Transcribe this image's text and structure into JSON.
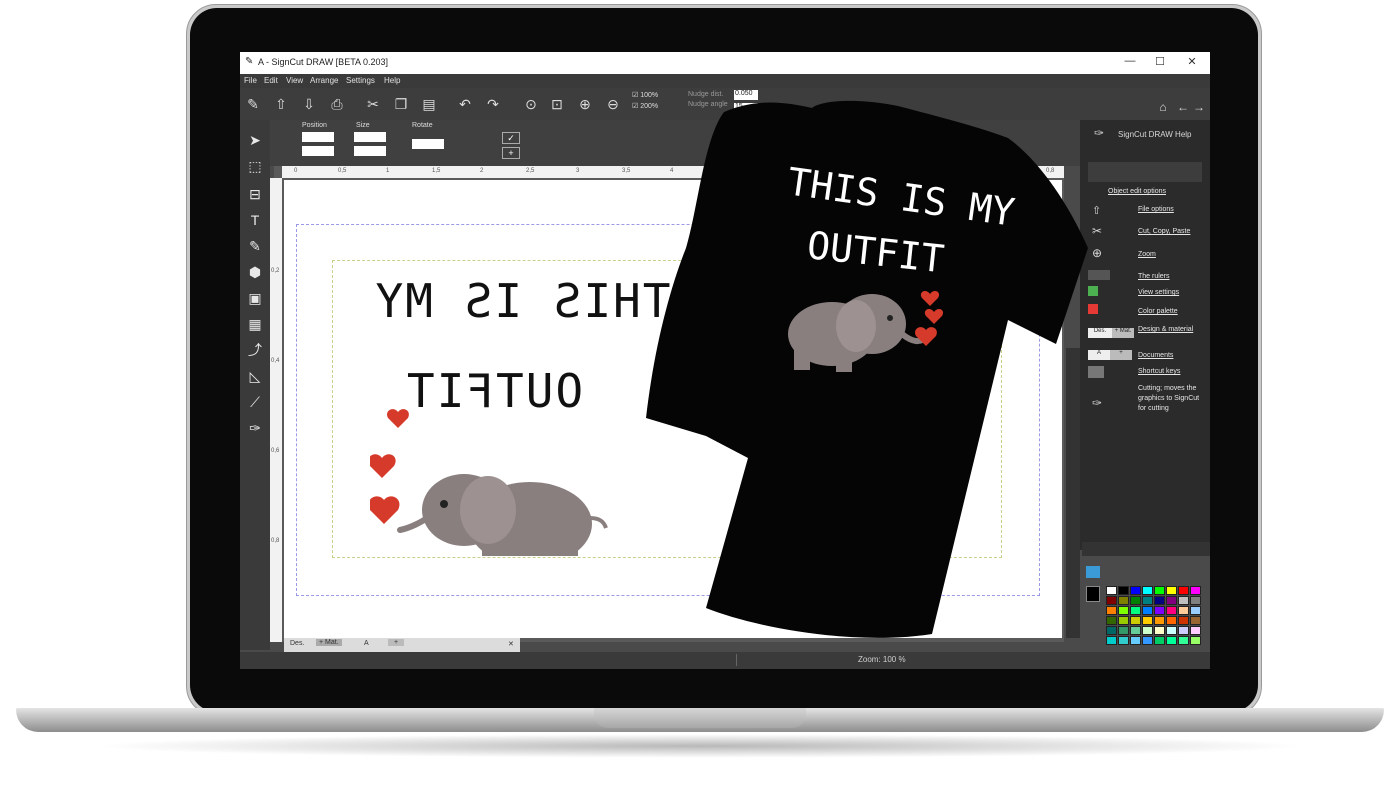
{
  "window": {
    "title": "A - SignCut DRAW  [BETA 0.203]",
    "controls": {
      "minimize": "—",
      "maximize": "☐",
      "close": "✕"
    }
  },
  "menu": [
    "File",
    "Edit",
    "View",
    "Arrange",
    "Settings",
    "Help"
  ],
  "toolbar": {
    "zoom_100": "100%",
    "zoom_200": "200%",
    "nudge_dist_label": "Nudge dist.",
    "nudge_dist_value": "0.050",
    "nudge_angle_label": "Nudge angle",
    "nudge_angle_value": "15"
  },
  "properties": {
    "position_label": "Position",
    "size_label": "Size",
    "rotate_label": "Rotate"
  },
  "ruler_h": [
    "0",
    "0,5",
    "1",
    "1,5",
    "2",
    "2,5",
    "3",
    "3,5",
    "4",
    "0,8"
  ],
  "ruler_v": [
    "0,2",
    "0,4",
    "0,6",
    "0,8"
  ],
  "canvas": {
    "mirrored_line1": "THIS IS MY",
    "mirrored_line2": "OUTFIT"
  },
  "tshirt": {
    "line1": "THIS IS MY",
    "line2": "OUTFIT"
  },
  "help_panel": {
    "title": "SignCut DRAW Help",
    "object_edit_options": "Object edit options",
    "items": [
      "File options",
      "Cut, Copy, Paste",
      "Zoom",
      "The rulers",
      "View settings",
      "Color palette",
      "Design & material",
      "Documents",
      "Shortcut keys"
    ],
    "cutting_note": "Cutting; moves the graphics to SignCut for cutting",
    "design_tab": "Des.",
    "material_tab": "+ Mat.",
    "doc_tab": "A",
    "add_doc": "+"
  },
  "bottom_tabs": {
    "des": "Des.",
    "mat": "+ Mat.",
    "doc": "A",
    "add": "+",
    "close": "✕"
  },
  "status": {
    "zoom": "Zoom: 100 %"
  },
  "palette_colors": [
    "#ffffff",
    "#000000",
    "#0000ff",
    "#00ffff",
    "#00ff00",
    "#ffff00",
    "#ff0000",
    "#ff00ff",
    "#800000",
    "#808000",
    "#008000",
    "#008080",
    "#000080",
    "#800080",
    "#c0c0c0",
    "#808080",
    "#ff8000",
    "#80ff00",
    "#00ff80",
    "#0080ff",
    "#8000ff",
    "#ff0080",
    "#ffcc99",
    "#99ccff",
    "#336600",
    "#99cc00",
    "#cccc00",
    "#ffcc00",
    "#ff9900",
    "#ff6600",
    "#cc3300",
    "#996633",
    "#006666",
    "#339966",
    "#66cc99",
    "#ccffcc",
    "#ffffcc",
    "#ccffff",
    "#ccccff",
    "#ffccff",
    "#00cccc",
    "#33cccc",
    "#66ccff",
    "#3399ff",
    "#00cc66",
    "#00ff99",
    "#33ff99",
    "#99ff66"
  ],
  "accent": "#e04a3a"
}
